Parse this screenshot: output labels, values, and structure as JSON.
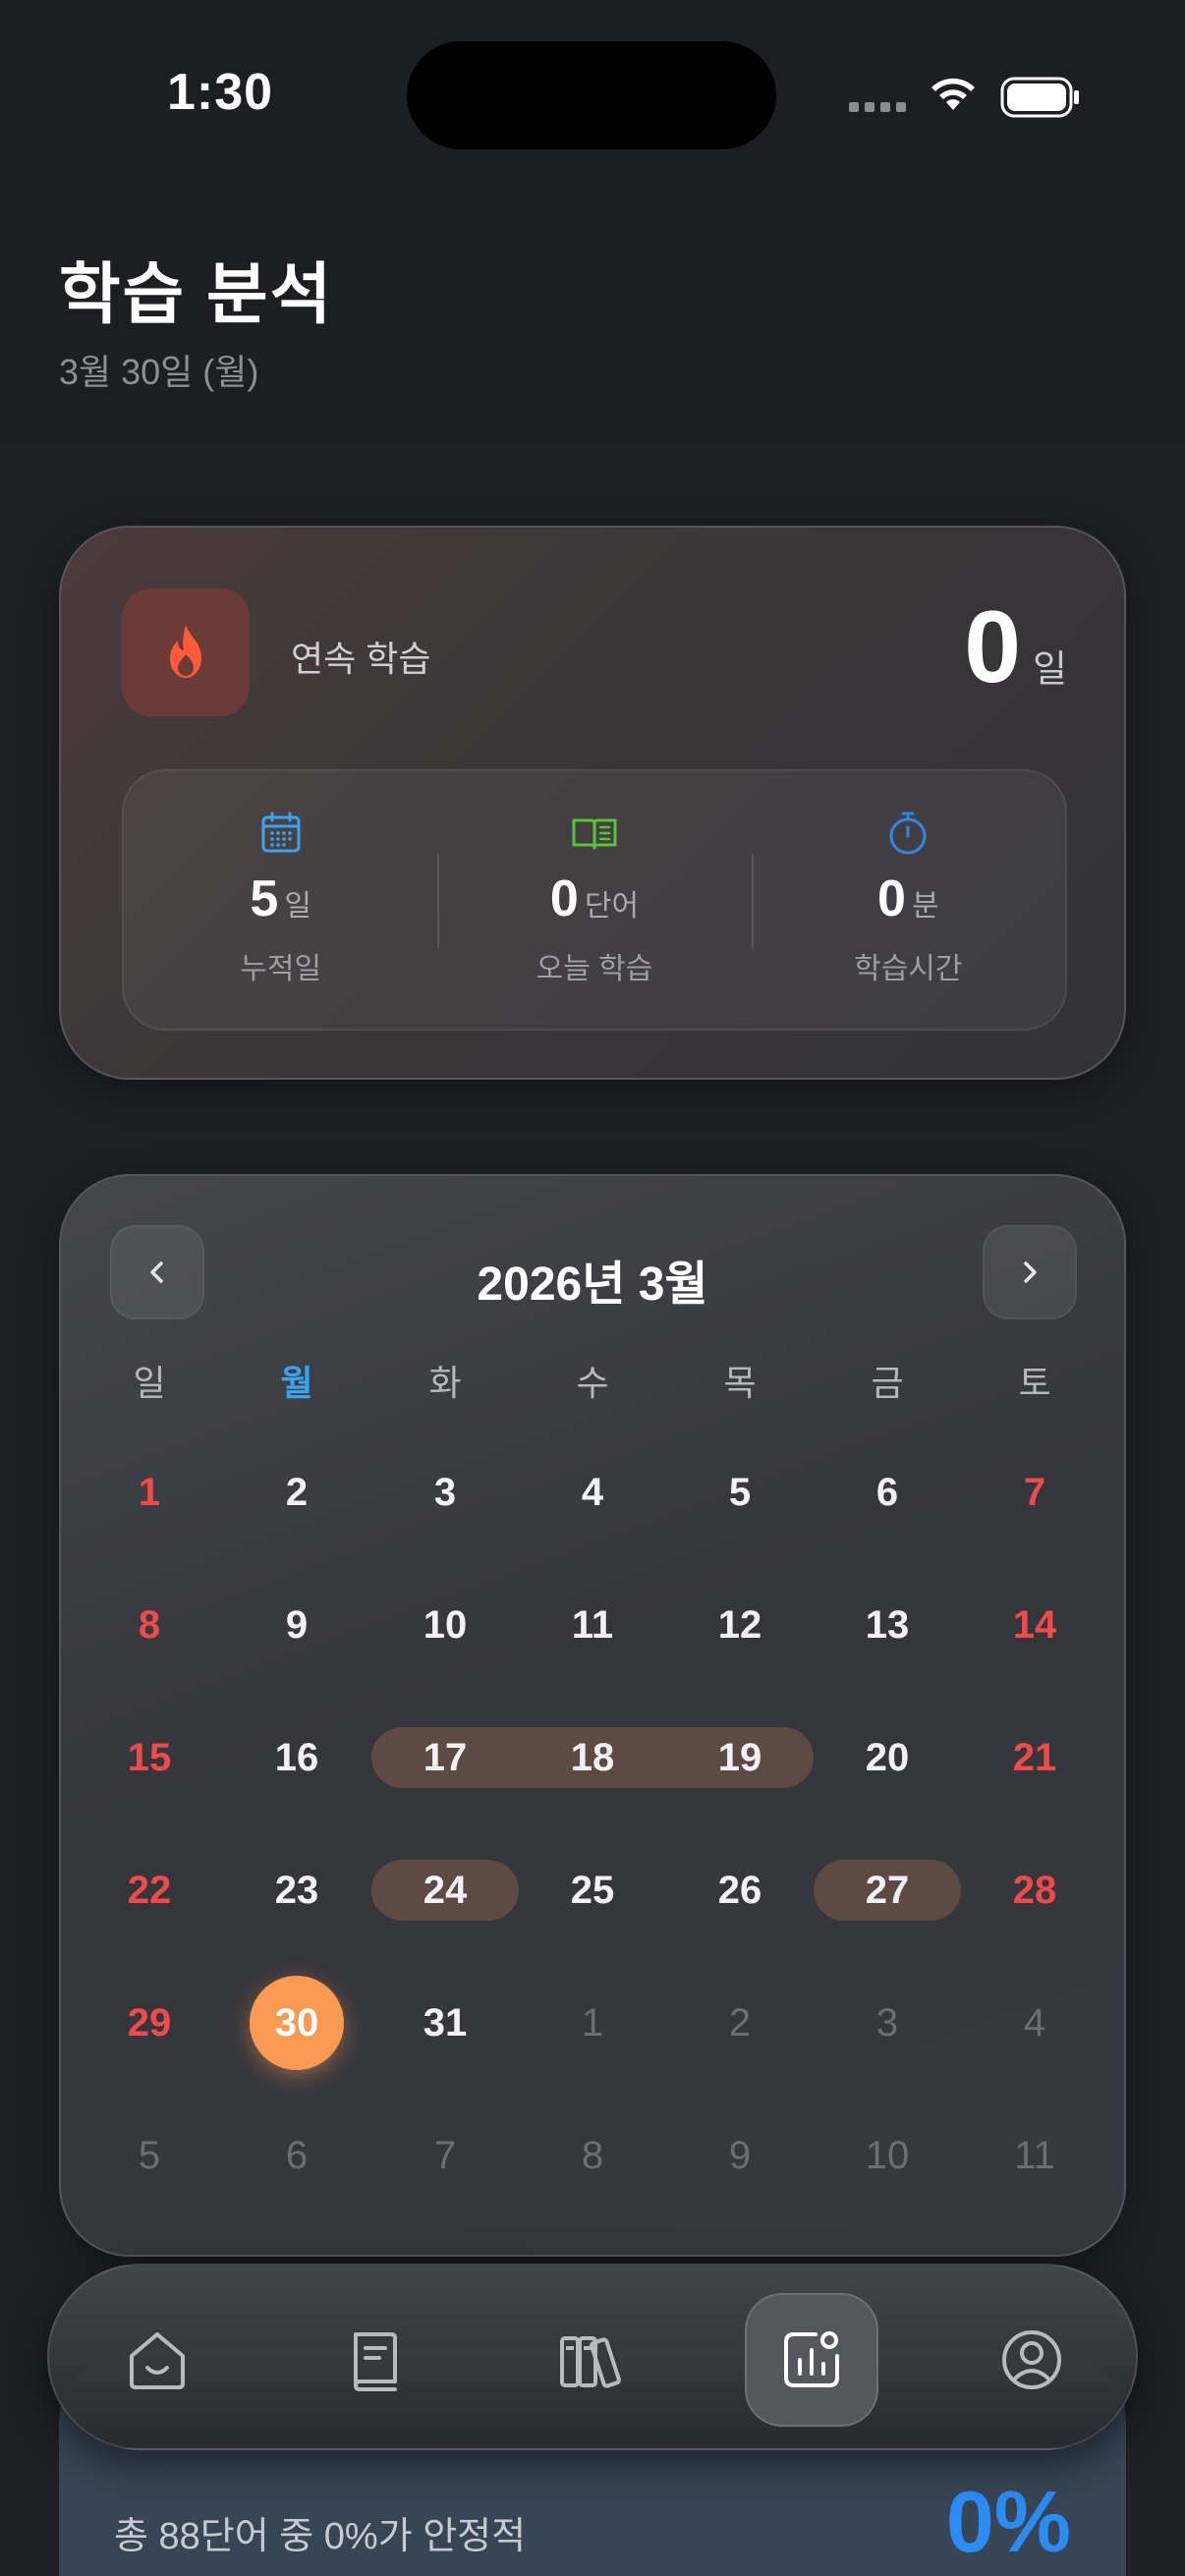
{
  "status": {
    "time": "1:30"
  },
  "header": {
    "title": "학습 분석",
    "date": "3월 30일 (월)"
  },
  "streak": {
    "label": "연속 학습",
    "value": "0",
    "unit": "일",
    "stats": [
      {
        "value": "5",
        "unit": "일",
        "label": "누적일",
        "icon": "calendar-icon",
        "color": "#3ba4f0"
      },
      {
        "value": "0",
        "unit": "단어",
        "label": "오늘 학습",
        "icon": "book-open-icon",
        "color": "#5bc23b"
      },
      {
        "value": "0",
        "unit": "분",
        "label": "학습시간",
        "icon": "stopwatch-icon",
        "color": "#2f86e6"
      }
    ]
  },
  "calendar": {
    "title": "2026년 3월",
    "weekdays": [
      "일",
      "월",
      "화",
      "수",
      "목",
      "금",
      "토"
    ],
    "weeks": [
      [
        "1",
        "2",
        "3",
        "4",
        "5",
        "6",
        "7"
      ],
      [
        "8",
        "9",
        "10",
        "11",
        "12",
        "13",
        "14"
      ],
      [
        "15",
        "16",
        "17",
        "18",
        "19",
        "20",
        "21"
      ],
      [
        "22",
        "23",
        "24",
        "25",
        "26",
        "27",
        "28"
      ],
      [
        "29",
        "30",
        "31",
        "1",
        "2",
        "3",
        "4"
      ],
      [
        "5",
        "6",
        "7",
        "8",
        "9",
        "10",
        "11"
      ]
    ],
    "today": "30",
    "studied_days": [
      "17",
      "18",
      "19",
      "24",
      "27"
    ],
    "colors": {
      "weekend": "#ef4b4b",
      "today": "#f99a52",
      "studied": "#5d4a43",
      "weekday_header_today": "#3ba4f0"
    }
  },
  "mastery": {
    "text": "총 88단어 중 0%가 안정적",
    "percent": "0%"
  },
  "tabs": [
    {
      "name": "home",
      "icon": "home-icon",
      "active": false
    },
    {
      "name": "wordbook",
      "icon": "notebook-icon",
      "active": false
    },
    {
      "name": "library",
      "icon": "books-icon",
      "active": false
    },
    {
      "name": "analytics",
      "icon": "chart-icon",
      "active": true
    },
    {
      "name": "profile",
      "icon": "profile-icon",
      "active": false
    }
  ]
}
